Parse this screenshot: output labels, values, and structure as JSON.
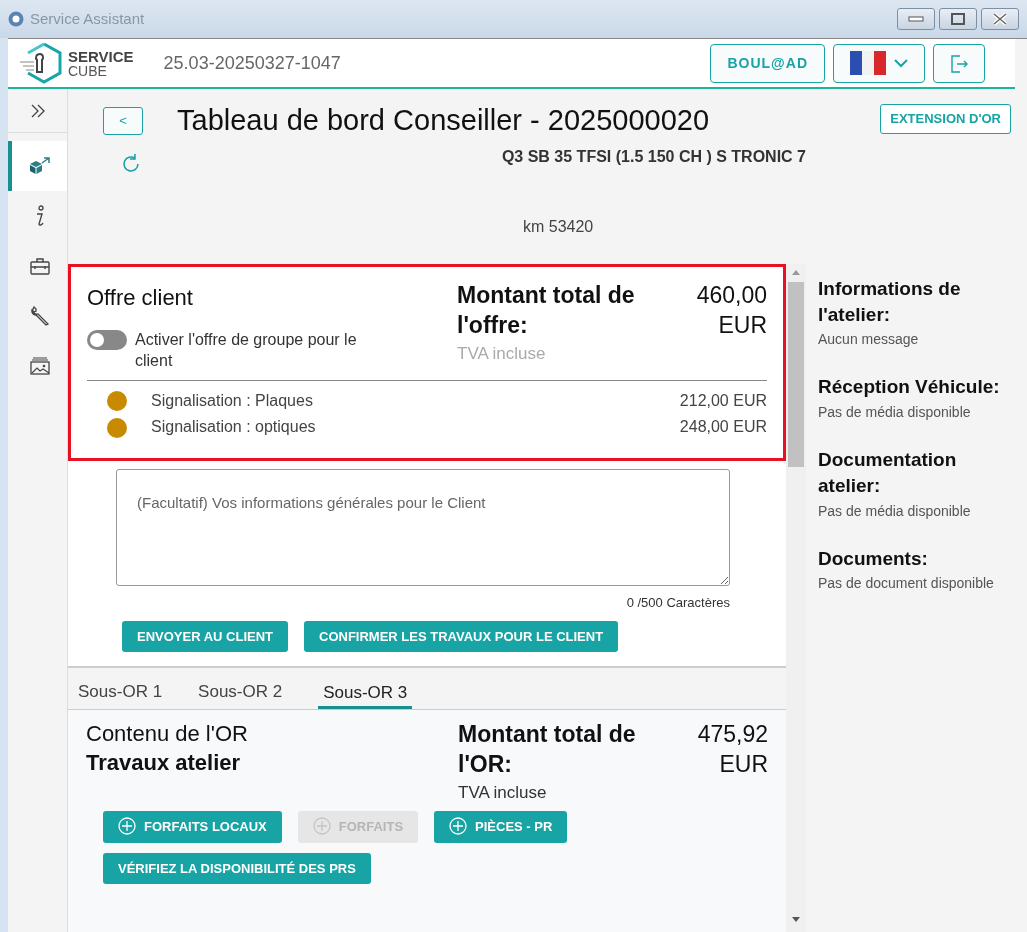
{
  "window": {
    "title": "Service Assistant"
  },
  "header": {
    "logo_line1": "SERVICE",
    "logo_line2": "CUBE",
    "session": "25.03-20250327-1047",
    "user_button": "BOUL@AD"
  },
  "sidebar": {
    "items": [
      {
        "kind": "parts",
        "selected": true
      },
      {
        "kind": "info",
        "selected": false
      },
      {
        "kind": "case",
        "selected": false
      },
      {
        "kind": "wrench",
        "selected": false
      },
      {
        "kind": "gallery",
        "selected": false
      }
    ]
  },
  "dashboard": {
    "back_button": "<",
    "title": "Tableau de bord Conseiller - 2025000020",
    "extension_button": "EXTENSION D'OR",
    "vehicle": "Q3 SB 35 TFSI (1.5 150 CH ) S TRONIC 7",
    "mileage": "km 53420"
  },
  "offer": {
    "title": "Offre client",
    "group_offer": {
      "label": "Activer l'offre de groupe pour le client",
      "on": false
    },
    "total_label": "Montant total de l'offre:",
    "total_value": "460,00 EUR",
    "vat": "TVA incluse",
    "lines": [
      {
        "label": "Signalisation : Plaques",
        "amount": "212,00 EUR",
        "color": "#c88a00"
      },
      {
        "label": "Signalisation : optiques",
        "amount": "248,00 EUR",
        "color": "#c88a00"
      }
    ]
  },
  "message": {
    "placeholder": "(Facultatif) Vos informations générales pour le Client",
    "counter": "0 /500 Caractères"
  },
  "actions": [
    "ENVOYER AU CLIENT",
    "CONFIRMER LES TRAVAUX POUR LE CLIENT"
  ],
  "sub_tabs": [
    {
      "label": "Sous-OR 1",
      "selected": false
    },
    {
      "label": "Sous-OR 2",
      "selected": false
    },
    {
      "label": "Sous-OR 3",
      "selected": true
    }
  ],
  "or_content": {
    "title": "Contenu de l'OR",
    "subtitle": "Travaux atelier",
    "total_label": "Montant total de l'OR:",
    "total_value": "475,92 EUR",
    "vat": "TVA incluse",
    "buttons": [
      {
        "label": "FORFAITS LOCAUX",
        "kind": "add",
        "disabled": false
      },
      {
        "label": "FORFAITS",
        "kind": "add",
        "disabled": true
      },
      {
        "label": "PIÈCES - PR",
        "kind": "add",
        "disabled": false
      },
      {
        "label": "VÉRIFIEZ LA DISPONIBILITÉ DES PRS",
        "kind": "plain",
        "disabled": false
      }
    ]
  },
  "side_panel": {
    "sections": [
      {
        "title": "Informations de l'atelier:",
        "text": "Aucun message"
      },
      {
        "title": "Réception Véhicule:",
        "text": "Pas de média disponible"
      },
      {
        "title": "Documentation atelier:",
        "text": "Pas de média disponible"
      },
      {
        "title": "Documents:",
        "text": "Pas de document disponible"
      }
    ]
  }
}
